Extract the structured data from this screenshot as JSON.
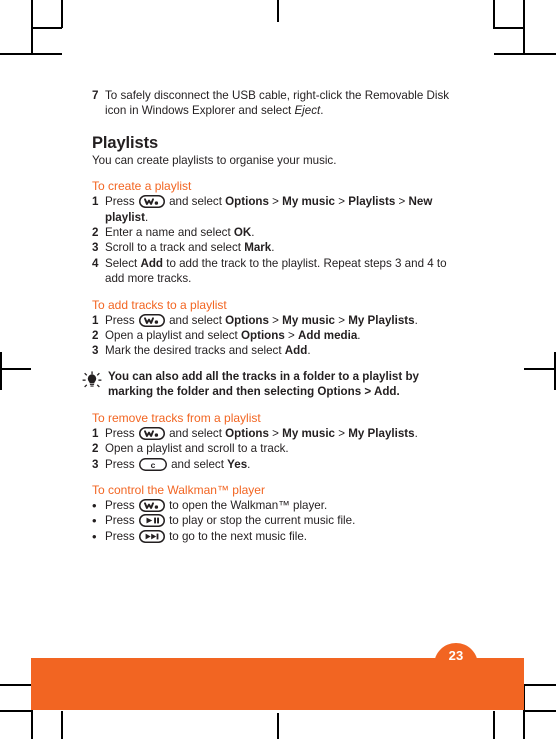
{
  "page": {
    "number": "23",
    "accent_color": "#f26522",
    "text_color": "#231f20"
  },
  "continued_step": {
    "number": "7",
    "text_part1": "To safely disconnect the USB cable, right-click the Removable Disk icon in Windows Explorer and select ",
    "text_italic": "Eject",
    "text_part2": "."
  },
  "section": {
    "title": "Playlists",
    "intro": "You can create playlists to organise your music."
  },
  "procedures": [
    {
      "title": "To create a playlist",
      "steps": [
        {
          "number": "1",
          "segments": [
            {
              "type": "text",
              "value": "Press "
            },
            {
              "type": "key",
              "value": "walkman-key"
            },
            {
              "type": "text",
              "value": " and select "
            },
            {
              "type": "bold",
              "value": "Options"
            },
            {
              "type": "text",
              "value": " > "
            },
            {
              "type": "bold",
              "value": "My music"
            },
            {
              "type": "text",
              "value": " > "
            },
            {
              "type": "bold",
              "value": "Playlists"
            },
            {
              "type": "text",
              "value": " > "
            },
            {
              "type": "bold",
              "value": "New playlist"
            },
            {
              "type": "text",
              "value": "."
            }
          ]
        },
        {
          "number": "2",
          "segments": [
            {
              "type": "text",
              "value": "Enter a name and select "
            },
            {
              "type": "bold",
              "value": "OK"
            },
            {
              "type": "text",
              "value": "."
            }
          ]
        },
        {
          "number": "3",
          "segments": [
            {
              "type": "text",
              "value": "Scroll to a track and select "
            },
            {
              "type": "bold",
              "value": "Mark"
            },
            {
              "type": "text",
              "value": "."
            }
          ]
        },
        {
          "number": "4",
          "segments": [
            {
              "type": "text",
              "value": "Select "
            },
            {
              "type": "bold",
              "value": "Add"
            },
            {
              "type": "text",
              "value": " to add the track to the playlist. Repeat steps 3 and 4 to add more tracks."
            }
          ]
        }
      ]
    },
    {
      "title": "To add tracks to a playlist",
      "steps": [
        {
          "number": "1",
          "segments": [
            {
              "type": "text",
              "value": "Press "
            },
            {
              "type": "key",
              "value": "walkman-key"
            },
            {
              "type": "text",
              "value": " and select "
            },
            {
              "type": "bold",
              "value": "Options"
            },
            {
              "type": "text",
              "value": " > "
            },
            {
              "type": "bold",
              "value": "My music"
            },
            {
              "type": "text",
              "value": " > "
            },
            {
              "type": "bold",
              "value": "My Playlists"
            },
            {
              "type": "text",
              "value": "."
            }
          ]
        },
        {
          "number": "2",
          "segments": [
            {
              "type": "text",
              "value": "Open a playlist and select "
            },
            {
              "type": "bold",
              "value": "Options"
            },
            {
              "type": "text",
              "value": " > "
            },
            {
              "type": "bold",
              "value": "Add media"
            },
            {
              "type": "text",
              "value": "."
            }
          ]
        },
        {
          "number": "3",
          "segments": [
            {
              "type": "text",
              "value": "Mark the desired tracks and select "
            },
            {
              "type": "bold",
              "value": "Add"
            },
            {
              "type": "text",
              "value": "."
            }
          ]
        }
      ]
    },
    {
      "title": "To remove tracks from a playlist",
      "steps": [
        {
          "number": "1",
          "segments": [
            {
              "type": "text",
              "value": "Press "
            },
            {
              "type": "key",
              "value": "walkman-key"
            },
            {
              "type": "text",
              "value": " and select "
            },
            {
              "type": "bold",
              "value": "Options"
            },
            {
              "type": "text",
              "value": " > "
            },
            {
              "type": "bold",
              "value": "My music"
            },
            {
              "type": "text",
              "value": " > "
            },
            {
              "type": "bold",
              "value": "My Playlists"
            },
            {
              "type": "text",
              "value": "."
            }
          ]
        },
        {
          "number": "2",
          "segments": [
            {
              "type": "text",
              "value": "Open a playlist and scroll to a track."
            }
          ]
        },
        {
          "number": "3",
          "segments": [
            {
              "type": "text",
              "value": "Press "
            },
            {
              "type": "key",
              "value": "clear-key"
            },
            {
              "type": "text",
              "value": " and select "
            },
            {
              "type": "bold",
              "value": "Yes"
            },
            {
              "type": "text",
              "value": "."
            }
          ]
        }
      ]
    },
    {
      "title": "To control the Walkman™ player",
      "bullets": [
        {
          "segments": [
            {
              "type": "text",
              "value": "Press "
            },
            {
              "type": "key",
              "value": "walkman-key"
            },
            {
              "type": "text",
              "value": " to open the Walkman™ player."
            }
          ]
        },
        {
          "segments": [
            {
              "type": "text",
              "value": "Press "
            },
            {
              "type": "key",
              "value": "play-pause-key"
            },
            {
              "type": "text",
              "value": " to play or stop the current music file."
            }
          ]
        },
        {
          "segments": [
            {
              "type": "text",
              "value": "Press "
            },
            {
              "type": "key",
              "value": "next-track-key"
            },
            {
              "type": "text",
              "value": " to go to the next music file."
            }
          ]
        }
      ]
    }
  ],
  "tip": {
    "icon": "lightbulb-icon",
    "segments": [
      {
        "type": "text",
        "value": "You can also add all the tracks in a folder to a playlist by marking the folder and then selecting "
      },
      {
        "type": "bold",
        "value": "Options"
      },
      {
        "type": "text",
        "value": " > "
      },
      {
        "type": "bold",
        "value": "Add"
      },
      {
        "type": "text",
        "value": "."
      }
    ]
  }
}
